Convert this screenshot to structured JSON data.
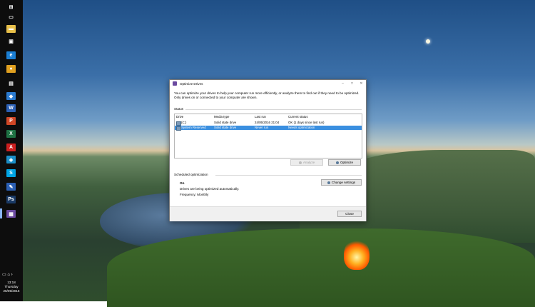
{
  "taskbar": {
    "clock": {
      "time": "13:18",
      "day": "Thursday",
      "date": "26/05/2016"
    },
    "icons": [
      {
        "name": "start-icon",
        "glyph": "⊞",
        "color": "#0d0d0d"
      },
      {
        "name": "task-view-icon",
        "glyph": "▭",
        "color": "#0d0d0d"
      },
      {
        "name": "file-explorer-icon",
        "glyph": "▬",
        "color": "#e8c04a"
      },
      {
        "name": "store-icon",
        "glyph": "▣",
        "color": "#0d0d0d"
      },
      {
        "name": "edge-icon",
        "glyph": "e",
        "color": "#1b7fd4"
      },
      {
        "name": "chrome-icon",
        "glyph": "●",
        "color": "#e0a020"
      },
      {
        "name": "network-icon",
        "glyph": "▤",
        "color": "#0d0d0d"
      },
      {
        "name": "vs-code-icon",
        "glyph": "◆",
        "color": "#2b7bd0"
      },
      {
        "name": "word-icon",
        "glyph": "W",
        "color": "#2b5fb4"
      },
      {
        "name": "powerpoint-icon",
        "glyph": "P",
        "color": "#d24726"
      },
      {
        "name": "excel-icon",
        "glyph": "X",
        "color": "#1f7244"
      },
      {
        "name": "acrobat-icon",
        "glyph": "A",
        "color": "#cc1f1f"
      },
      {
        "name": "app-icon",
        "glyph": "◈",
        "color": "#1b8fc8"
      },
      {
        "name": "skype-icon",
        "glyph": "S",
        "color": "#00a4e4"
      },
      {
        "name": "paint-icon",
        "glyph": "✎",
        "color": "#2b5fb4"
      },
      {
        "name": "photoshop-icon",
        "glyph": "Ps",
        "color": "#1a3a66"
      },
      {
        "name": "optimize-drives-icon",
        "glyph": "▦",
        "color": "#6b4aa0"
      }
    ]
  },
  "dialog": {
    "title": "Optimize Drives",
    "description": "You can optimize your drives to help your computer run more efficiently, or analyze them to find out if they need to be optimized. Only drives on or connected to your computer are shown.",
    "status_label": "Status",
    "columns": [
      "Drive",
      "Media type",
      "Last run",
      "Current status"
    ],
    "rows": [
      {
        "drive": "(C:)",
        "media_type": "Solid state drive",
        "last_run": "24/05/2016 21:04",
        "current_status": "OK (1 days since last run)"
      },
      {
        "drive": "System Reserved",
        "media_type": "Solid state drive",
        "last_run": "Never run",
        "current_status": "Needs optimization"
      }
    ],
    "analyze_label": "Analyze",
    "optimize_label": "Optimize",
    "scheduled_label": "Scheduled optimization",
    "schedule_state": "On",
    "schedule_info": "Drives are being optimized automatically.",
    "frequency": "Frequency: Monthly",
    "change_settings_label": "Change settings",
    "close_label": "Close"
  },
  "colors": {
    "selection": "#3a8fe0",
    "taskbar": "#0d0d0d"
  }
}
